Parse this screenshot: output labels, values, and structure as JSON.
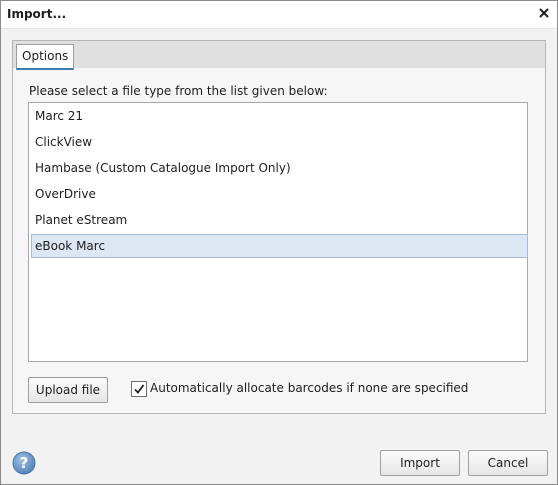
{
  "window": {
    "title": "Import..."
  },
  "tabs": [
    {
      "label": "Options",
      "selected": true
    }
  ],
  "prompt": "Please select a file type from the list given below:",
  "file_types": [
    {
      "label": "Marc 21",
      "selected": false
    },
    {
      "label": "ClickView",
      "selected": false
    },
    {
      "label": "Hambase (Custom Catalogue Import Only)",
      "selected": false
    },
    {
      "label": "OverDrive",
      "selected": false
    },
    {
      "label": "Planet eStream",
      "selected": false
    },
    {
      "label": "eBook Marc",
      "selected": true
    }
  ],
  "upload_button": "Upload file",
  "auto_barcodes": {
    "label": "Automatically allocate barcodes if none are specified",
    "checked": true
  },
  "footer": {
    "import_label": "Import",
    "cancel_label": "Cancel"
  },
  "icons": {
    "close": "close-icon",
    "help": "help-icon",
    "check": "checkmark-icon"
  },
  "colors": {
    "accent": "#3c7fb1",
    "selection": "#dde6f3",
    "help_blue": "#5b8fc7"
  }
}
